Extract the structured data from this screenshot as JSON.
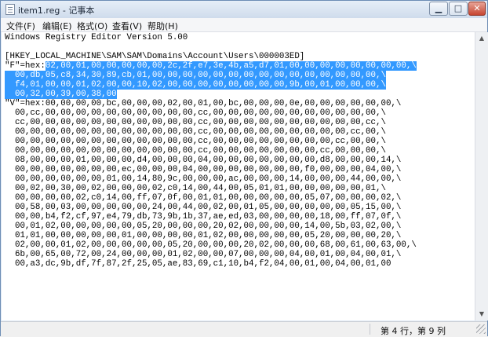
{
  "window": {
    "title": "item1.reg - 记事本",
    "min_label": "▁",
    "max_label": "□",
    "close_label": "✕"
  },
  "menu": [
    "文件(F)",
    "编辑(E)",
    "格式(O)",
    "查看(V)",
    "帮助(H)"
  ],
  "document": {
    "lines": [
      [
        {
          "t": "Windows Registry Editor Version 5.00"
        }
      ],
      [
        {
          "t": ""
        }
      ],
      [
        {
          "t": "[HKEY_LOCAL_MACHINE\\SAM\\SAM\\Domains\\Account\\Users\\000003ED]"
        }
      ],
      [
        {
          "t": "\"F\"=hex:"
        },
        {
          "t": "02,00,01,00,00,00,00,00,2c,2f,e7,3e,4b,a5,d7,01,00,00,00,00,00,00,00,00,\\",
          "s": true
        }
      ],
      [
        {
          "t": "  00,db,05,c8,34,30,89,cb,01,00,00,00,00,00,00,00,00,00,00,00,00,00,00,00,\\",
          "s": true
        }
      ],
      [
        {
          "t": "  f4,01,00,00,01,02,00,00,10,02,00,00,00,00,00,00,00,00,9b,00,01,00,00,00,\\",
          "s": true
        }
      ],
      [
        {
          "t": "  00,32,00,39,00,38,00",
          "s": true
        }
      ],
      [
        {
          "t": "\"V\"=hex:00,00,00,00,bc,00,00,00,02,00,01,00,bc,00,00,00,0e,00,00,00,00,00,00,\\"
        }
      ],
      [
        {
          "t": "  00,cc,00,00,00,00,00,00,00,00,00,00,cc,00,00,00,00,00,00,00,00,00,00,00,\\"
        }
      ],
      [
        {
          "t": "  cc,00,00,00,00,00,00,00,00,00,00,00,cc,00,00,00,00,00,00,00,00,00,00,cc,\\"
        }
      ],
      [
        {
          "t": "  00,00,00,00,00,00,00,00,00,00,00,00,cc,00,00,00,00,00,00,00,00,00,cc,00,\\"
        }
      ],
      [
        {
          "t": "  00,00,00,00,00,00,00,00,00,00,00,00,cc,00,00,00,00,00,00,00,00,cc,00,00,\\"
        }
      ],
      [
        {
          "t": "  00,00,00,00,00,00,00,00,00,00,00,00,cc,00,00,00,00,00,00,00,cc,00,00,00,\\"
        }
      ],
      [
        {
          "t": "  08,00,00,00,01,00,00,00,d4,00,00,00,04,00,00,00,00,00,00,00,d8,00,00,00,14,\\"
        }
      ],
      [
        {
          "t": "  00,00,00,00,00,00,00,ec,00,00,00,04,00,00,00,00,00,00,00,f0,00,00,00,04,00,\\"
        }
      ],
      [
        {
          "t": "  00,00,00,00,00,00,01,00,14,80,9c,00,00,00,ac,00,00,00,14,00,00,00,44,00,00,\\"
        }
      ],
      [
        {
          "t": "  00,02,00,30,00,02,00,00,00,02,c0,14,00,44,00,05,01,01,00,00,00,00,00,01,\\"
        }
      ],
      [
        {
          "t": "  00,00,00,00,02,c0,14,00,ff,07,0f,00,01,01,00,00,00,00,00,05,07,00,00,00,02,\\"
        }
      ],
      [
        {
          "t": "  00,58,00,03,00,00,00,00,00,24,00,44,00,02,00,01,05,00,00,00,00,00,05,15,00,\\"
        }
      ],
      [
        {
          "t": "  00,00,b4,f2,cf,97,e4,79,db,73,9b,1b,37,ae,ed,03,00,00,00,00,18,00,ff,07,0f,\\"
        }
      ],
      [
        {
          "t": "  00,01,02,00,00,00,00,00,05,20,00,00,00,20,02,00,00,00,00,14,00,5b,03,02,00,\\"
        }
      ],
      [
        {
          "t": "  01,01,00,00,00,00,00,01,00,00,00,00,01,02,00,00,00,00,00,05,20,00,00,00,20,\\"
        }
      ],
      [
        {
          "t": "  02,00,00,01,02,00,00,00,00,00,05,20,00,00,00,20,02,00,00,00,68,00,61,00,63,00,\\"
        }
      ],
      [
        {
          "t": "  6b,00,65,00,72,00,24,00,00,00,01,02,00,00,07,00,00,00,04,00,01,00,04,00,01,\\"
        }
      ],
      [
        {
          "t": "  00,a3,dc,9b,df,7f,87,2f,25,05,ae,83,69,c1,10,b4,f2,04,00,01,00,04,00,01,00"
        }
      ]
    ]
  },
  "status": {
    "position": "第 4 行，第 9 列"
  }
}
